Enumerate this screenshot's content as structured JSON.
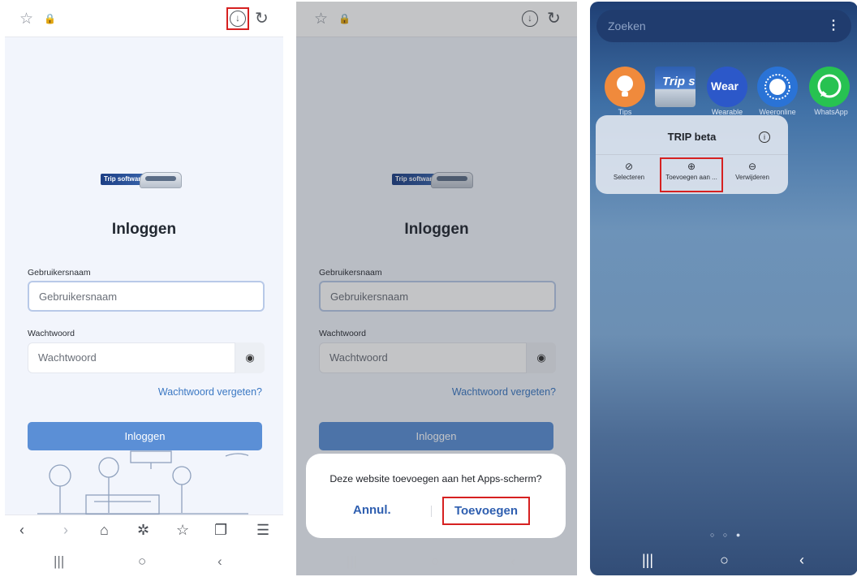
{
  "icons": {
    "star": "☆",
    "lock": "🔒",
    "download": "↓",
    "reload": "↻",
    "eye": "◉",
    "back": "‹",
    "forward": "›",
    "home": "⌂",
    "ai": "✲",
    "bookmarks": "☆",
    "tabs": "❐",
    "menu": "☰",
    "recents": "|||",
    "homebtn": "○",
    "backbtn": "‹",
    "more": "⋮",
    "select": "⊘",
    "add": "⊕",
    "remove": "⊖",
    "info": "i"
  },
  "screen1": {
    "logo_text": "Trip software",
    "title": "Inloggen",
    "username_label": "Gebruikersnaam",
    "username_placeholder": "Gebruikersnaam",
    "password_label": "Wachtwoord",
    "password_placeholder": "Wachtwoord",
    "forgot_link": "Wachtwoord vergeten?",
    "login_button": "Inloggen",
    "tab_count": "1"
  },
  "screen2": {
    "logo_text": "Trip software",
    "title": "Inloggen",
    "username_label": "Gebruikersnaam",
    "username_placeholder": "Gebruikersnaam",
    "password_label": "Wachtwoord",
    "password_placeholder": "Wachtwoord",
    "forgot_link": "Wachtwoord vergeten?",
    "login_button": "Inloggen",
    "dialog": {
      "question": "Deze website toevoegen aan het Apps-scherm?",
      "cancel": "Annul.",
      "confirm": "Toevoegen"
    }
  },
  "screen3": {
    "search_placeholder": "Zoeken",
    "apps": [
      {
        "label": "Tips",
        "color": "#f08a3c"
      },
      {
        "label": "TRIP beta",
        "color": "#3a6fc2"
      },
      {
        "label": "Wearable",
        "color": "#2c58c9"
      },
      {
        "label": "Weeronline",
        "color": "#2a73d6"
      },
      {
        "label": "WhatsApp",
        "color": "#27c251"
      }
    ],
    "trip_icon_text": "Trip s",
    "wear_icon_text": "Wear",
    "context_menu": {
      "title": "TRIP beta",
      "items": [
        "Selecteren",
        "Toevoegen aan ...",
        "Verwijderen"
      ]
    },
    "page_dots": "○ ○ ●"
  }
}
